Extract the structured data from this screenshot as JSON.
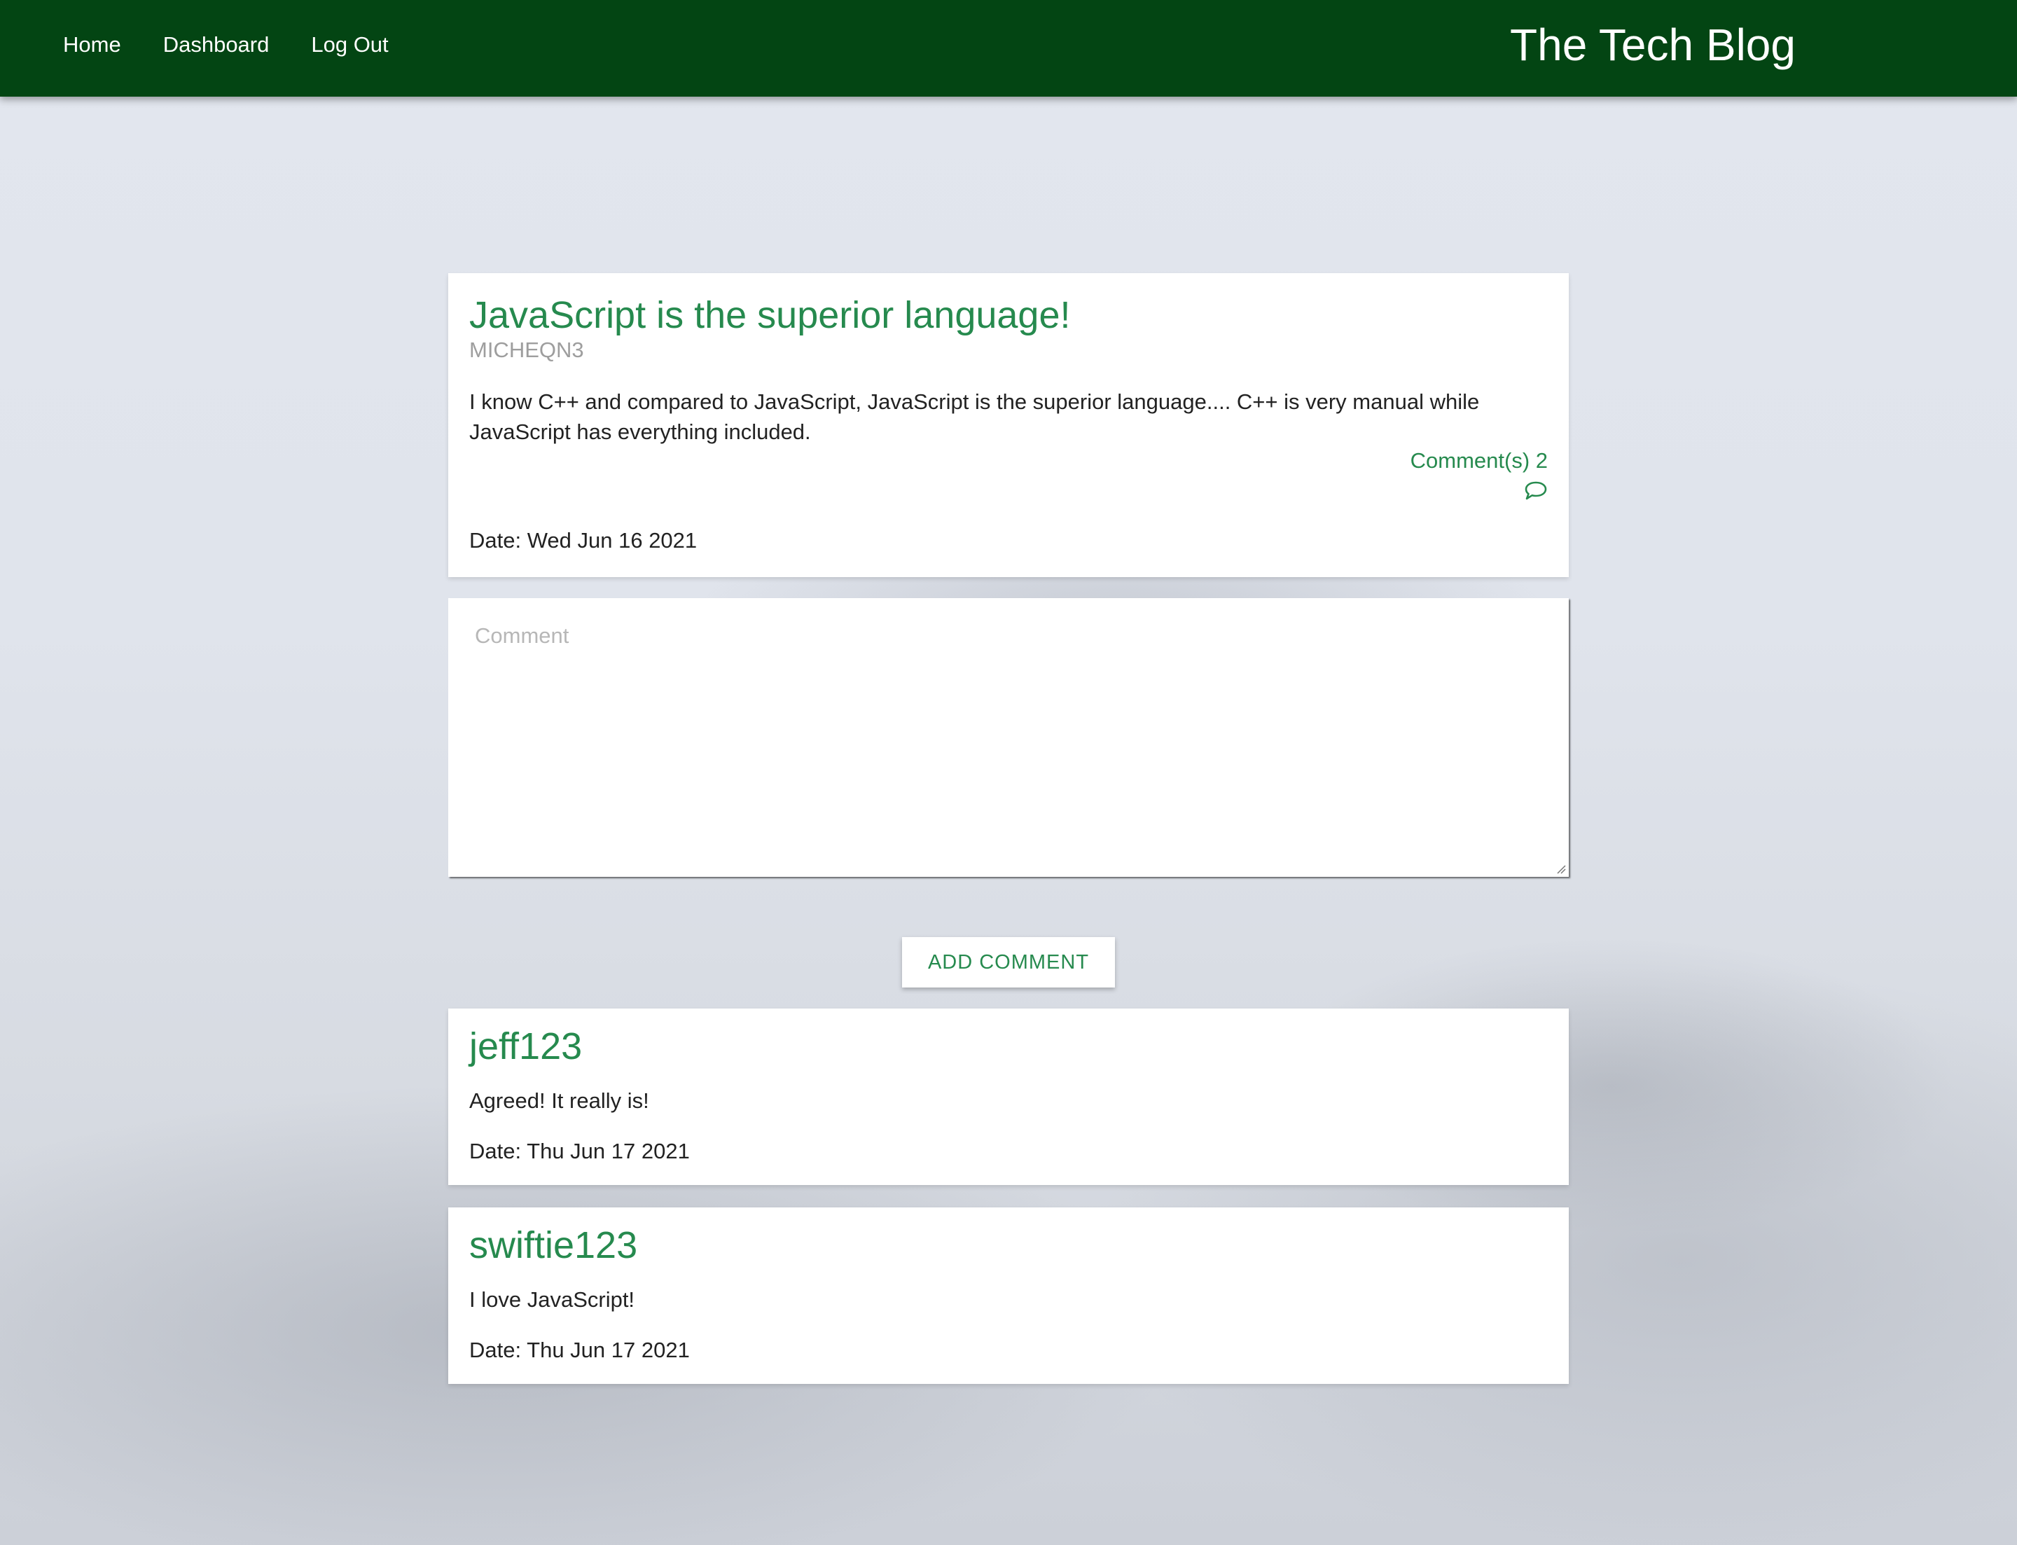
{
  "nav": {
    "links": [
      "Home",
      "Dashboard",
      "Log Out"
    ],
    "brand": "The Tech Blog"
  },
  "post": {
    "title": "JavaScript is the superior language!",
    "author": "MICHEQN3",
    "body": "I know C++ and compared to JavaScript, JavaScript is the superior language.... C++ is very manual while JavaScript has everything included.",
    "comment_count": "Comment(s) 2",
    "comment_icon": "speech-bubble-icon",
    "date": "Date: Wed Jun 16 2021"
  },
  "comment_form": {
    "placeholder": "Comment",
    "value": "",
    "submit_label": "ADD COMMENT"
  },
  "comments": [
    {
      "user": "jeff123",
      "text": "Agreed! It really is!",
      "date": "Date: Thu Jun 17 2021"
    },
    {
      "user": "swiftie123",
      "text": "I love JavaScript!",
      "date": "Date: Thu Jun 17 2021"
    }
  ],
  "colors": {
    "navbar": "#034513",
    "accent": "#268a4e",
    "author": "#9e9e9e"
  }
}
